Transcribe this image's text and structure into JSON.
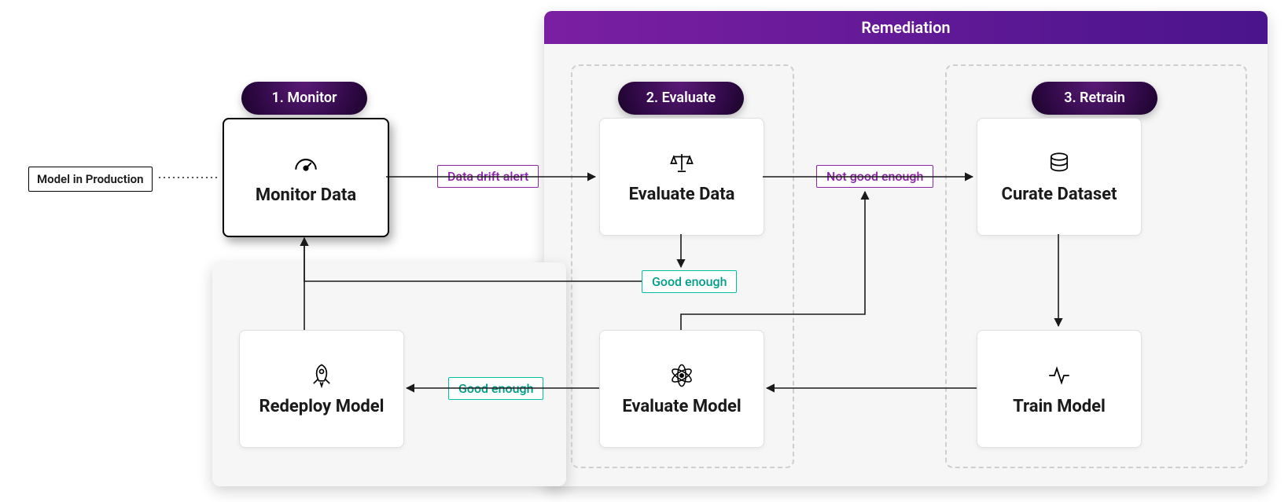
{
  "containers": {
    "remediation_title": "Remediation"
  },
  "stages": {
    "monitor": "1. Monitor",
    "evaluate": "2. Evaluate",
    "retrain": "3. Retrain"
  },
  "start": {
    "label": "Model in Production"
  },
  "nodes": {
    "monitor_data": "Monitor Data",
    "evaluate_data": "Evaluate Data",
    "curate_dataset": "Curate Dataset",
    "train_model": "Train Model",
    "evaluate_model": "Evaluate Model",
    "redeploy_model": "Redeploy Model"
  },
  "edges": {
    "data_drift_alert": "Data drift alert",
    "not_good_enough": "Not good enough",
    "good_enough_data": "Good enough",
    "good_enough_model": "Good enough"
  },
  "colors": {
    "purple": "#8e24aa",
    "teal": "#00bfa5",
    "black": "#1a1a1a"
  }
}
